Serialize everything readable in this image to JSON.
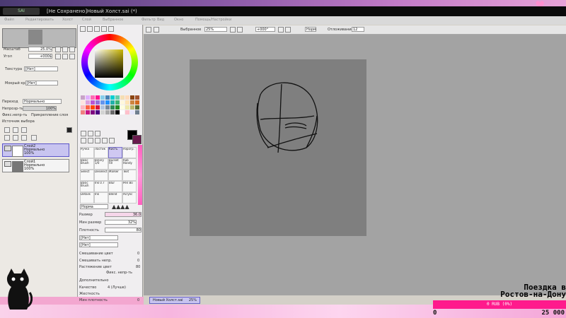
{
  "window": {
    "title": "[Не Сохранено]Новый Холст.sai (*)",
    "logo_text": "SAI"
  },
  "menu": [
    "Файл",
    "Редактировать",
    "Холст",
    "Слой",
    "Выбранное",
    "Фильтр",
    "Вид",
    "Окно",
    "Помощь/Настройки"
  ],
  "navigator": {
    "zoom_label": "Масштаб",
    "zoom_value": "25.0%",
    "angle_label": "Угол",
    "angle_value": "+000$"
  },
  "paper": {
    "texture_label": "Текстура",
    "texture_value": "[Нет]",
    "edge_label": "Мокрый край",
    "edge_value": "[Нет]"
  },
  "layer_props": {
    "mode_label": "Переход",
    "mode_value": "Нормально",
    "opacity_label": "Непрозр-ть",
    "opacity_value": "100%",
    "fix_opacity": "Фикс.непр-ть",
    "clip_layer": "Прикрепление слоя",
    "selection_source": "Источник выбора"
  },
  "layers": [
    {
      "name": "Слой2",
      "mode": "Нормально",
      "opacity": "100%",
      "selected": true
    },
    {
      "name": "Слой1",
      "mode": "Нормально",
      "opacity": "100%",
      "selected": false
    }
  ],
  "tools": [
    [
      "Ручка",
      "Ластик",
      "Кисть",
      "Аэрогр."
    ],
    [
      "Basic Brush",
      "Binary 1/0",
      "Bucket Fill",
      "Rub Handy"
    ],
    [
      "Select",
      "Deselect",
      "Marker",
      "Text"
    ],
    [
      "Basic Brush",
      "Ink 0.7",
      "Blur",
      "Pen Bo"
    ],
    [
      "Details",
      "Ink",
      "Blend",
      "Acrylic"
    ]
  ],
  "brush": {
    "mode_value": "Норма",
    "size_label": "Размер",
    "size_value": "36.0",
    "minsize_label": "Мин размер",
    "minsize_value": "32%",
    "density_label": "Плотность",
    "density_value": "80",
    "shape_value": "[Нет]",
    "texture_value": "[Нет]",
    "blend_label": "Смешивание цвет",
    "blend_value": "0",
    "dilution_label": "Смешивать непр.",
    "dilution_value": "0",
    "persistence_label": "Растяжение цвет",
    "persistence_value": "80",
    "keep_opacity": "Фикс. непр-ть",
    "advanced": "Дополнительно",
    "quality_label": "Качество",
    "quality_value": "4 (Лучше)",
    "hardness_label": "Жесткость",
    "min_density_label": "Мин плотность",
    "min_density_value": "0"
  },
  "canvas_toolbar": {
    "selection_label": "Выбранное",
    "zoom": "25%",
    "angle": "+000°",
    "mode": "Норм",
    "stabilizer_label": "Отложивание",
    "stabilizer_value": "12"
  },
  "document_tab": {
    "name": "Новый Холст.sai",
    "zoom": "25%"
  },
  "overlay": {
    "trip_line1": "Поездка в",
    "trip_line2": "Ростов-на-Дону",
    "goal_text": "0 RUB (0%)",
    "goal_start": "0",
    "goal_end": "25 000"
  },
  "colors": {
    "accent": "#c8c4f0",
    "stream_pink": "#ff1a8c",
    "canvas": "#7f7f7f",
    "workspace": "#a3a3a3"
  },
  "swatch_colors": [
    "#c8a2c8",
    "#e0b0ff",
    "#ff69b4",
    "#ff1493",
    "#87ceeb",
    "#4682b4",
    "#00ced1",
    "#66cdaa",
    "#f5deb3",
    "#ffdab9",
    "#8b4513",
    "#a0522d",
    "#ffe4e1",
    "#dda0dd",
    "#ba55d3",
    "#9370db",
    "#6495ed",
    "#1e90ff",
    "#20b2aa",
    "#3cb371",
    "#fff8dc",
    "#ffe4b5",
    "#cd853f",
    "#d2691e",
    "#ffb6c1",
    "#ff6347",
    "#ff4500",
    "#dc143c",
    "#b0c4de",
    "#778899",
    "#2e8b57",
    "#228b22",
    "#ffffe0",
    "#eee8aa",
    "#bdb76b",
    "#556b2f",
    "#f08080",
    "#c71585",
    "#800080",
    "#4b0082",
    "#d3d3d3",
    "#a9a9a9",
    "#696969",
    "#000000",
    "#ffffff",
    "#ffc0cb",
    "#e6e6fa",
    "#708090"
  ]
}
